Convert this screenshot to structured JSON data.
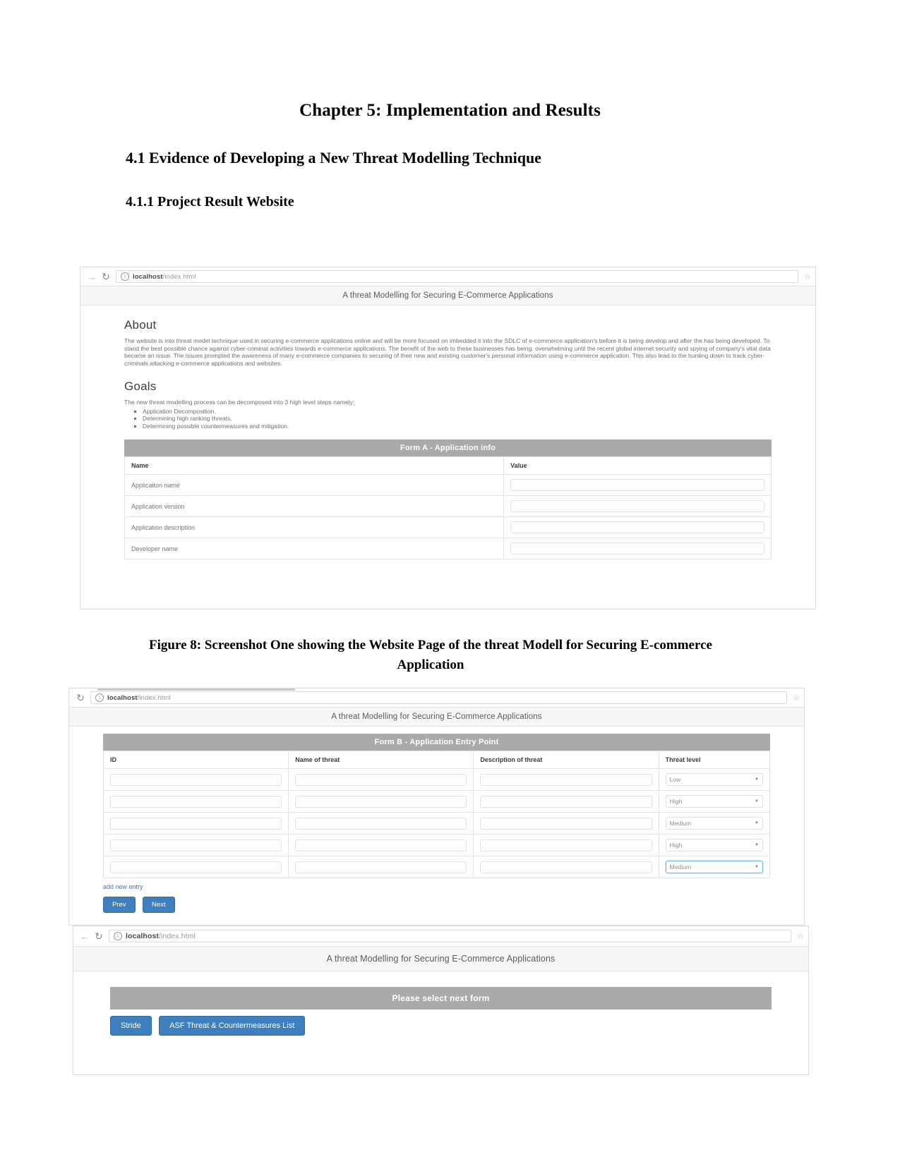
{
  "document": {
    "chapter_heading": "Chapter 5: Implementation and Results",
    "section_heading": "4.1 Evidence of Developing a New Threat Modelling Technique",
    "subsection_heading": "4.1.1 Project Result Website",
    "figure_caption": "Figure 8: Screenshot One showing the Website Page of the threat Modell for Securing E-commerce Application"
  },
  "browser": {
    "url_host": "localhost",
    "url_path": "/index.html",
    "icons": {
      "forward": "forward-arrow-icon",
      "reload": "reload-icon",
      "info": "site-info-icon",
      "bookmark": "star-icon"
    }
  },
  "site": {
    "banner_title": "A threat Modelling for Securing E-Commerce Applications"
  },
  "shot1": {
    "about": {
      "heading": "About",
      "paragraph": "The website is into threat model technique used in securing e-commerce applications online and will be more focused on imbedded it into the SDLC of e-commerce application's before it is being develop and after the has being developed. To stand the best possible chance against cyber-criminal activities towards e-commerce applications. The benefit of the web to these businesses has being. overwhelming until the recent global internet security and spying of company's vital data became an issue. The issues prompted the awareness of many e-commerce companies to securing of their new and existing customer's personal information using e-commerce application. This also lead to the hunting down to track cyber-criminals attacking e-commerce applications and websites."
    },
    "goals": {
      "heading": "Goals",
      "intro": "The new threat modelling process can be decomposed into 3 high level steps namely;",
      "items": [
        "Application Decomposition.",
        "Determining high ranking threats.",
        "Determining possible countermeasures and mitigation."
      ]
    },
    "form_a": {
      "title": "Form A - Application info",
      "columns": [
        "Name",
        "Value"
      ],
      "rows": [
        {
          "name": "Applicaiton name",
          "value": ""
        },
        {
          "name": "Application version",
          "value": ""
        },
        {
          "name": "Application description",
          "value": ""
        },
        {
          "name": "Developer name",
          "value": ""
        }
      ]
    }
  },
  "shot2": {
    "form_b": {
      "title": "Form B - Application Entry Point",
      "columns": [
        "ID",
        "Name of threat",
        "Description of threat",
        "Threat level"
      ],
      "rows": [
        {
          "id": "",
          "name_of_threat": "",
          "description_of_threat": "",
          "threat_level": "Low"
        },
        {
          "id": "",
          "name_of_threat": "",
          "description_of_threat": "",
          "threat_level": "High"
        },
        {
          "id": "",
          "name_of_threat": "",
          "description_of_threat": "",
          "threat_level": "Medium"
        },
        {
          "id": "",
          "name_of_threat": "",
          "description_of_threat": "",
          "threat_level": "High"
        },
        {
          "id": "",
          "name_of_threat": "",
          "description_of_threat": "",
          "threat_level": "Medium"
        }
      ],
      "add_entry_link": "add new entry",
      "prev_button": "Prev",
      "next_button": "Next"
    }
  },
  "shot3": {
    "select_form": {
      "title": "Please select next form",
      "buttons": [
        "Stride",
        "ASF Threat & Countermeasures List"
      ]
    }
  },
  "colors": {
    "panel_header": "#aaaaaa",
    "button_primary": "#3d7fbf",
    "link": "#3a7bbf",
    "banner_bg": "#f7f7f7"
  }
}
